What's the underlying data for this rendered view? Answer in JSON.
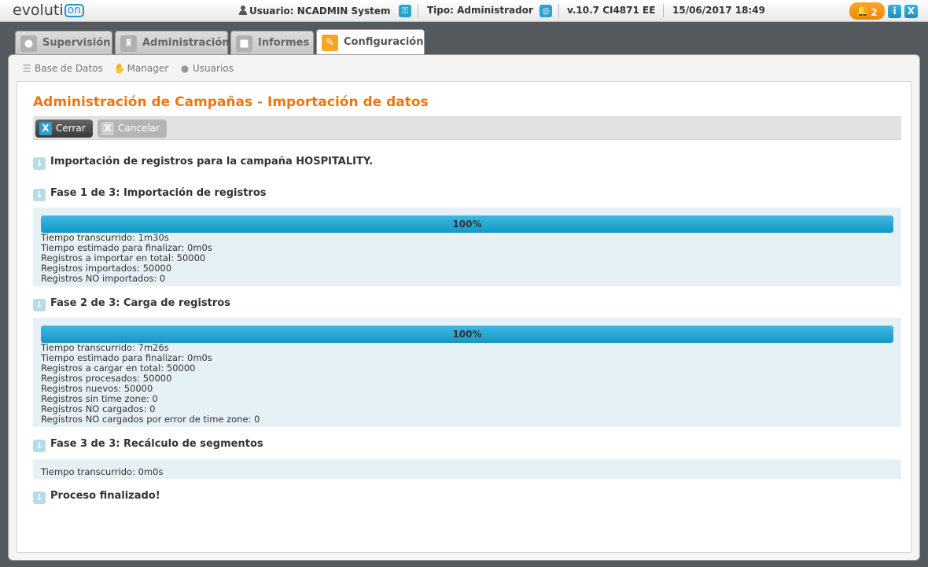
{
  "topbar": {
    "logo_text": "evoluti",
    "logo_badge": "on",
    "user_label": "Usuario: NCADMIN System",
    "type_label": "Tipo: Administrador",
    "version_label": "v.10.7 CI4871 EE",
    "datetime_label": "15/06/2017 18:49",
    "notification_count": "2",
    "info_label": "i",
    "close_label": "X"
  },
  "tabs": [
    {
      "label": "Supervisión"
    },
    {
      "label": "Administración"
    },
    {
      "label": "Informes"
    },
    {
      "label": "Configuración",
      "active": true
    }
  ],
  "subnav": [
    {
      "label": "Base de Datos"
    },
    {
      "label": "Manager"
    },
    {
      "label": "Usuarios"
    }
  ],
  "page": {
    "title": "Administración de Campañas - Importación de datos",
    "close_button": "Cerrar",
    "cancel_button": "Cancelar",
    "button_x": "X"
  },
  "intro": "Importación de registros para la campaña HOSPITALITY.",
  "phase1": {
    "title": "Fase 1 de 3: Importación de registros",
    "progress_percent": 100,
    "progress_label": "100%",
    "lines": [
      "Tiempo transcurrido: 1m30s",
      "Tiempo estimado para finalizar: 0m0s",
      "Registros a importar en total: 50000",
      "Registros importados: 50000",
      "Registros NO importados: 0"
    ]
  },
  "phase2": {
    "title": "Fase 2 de 3: Carga de registros",
    "progress_percent": 100,
    "progress_label": "100%",
    "lines": [
      "Tiempo transcurrido: 7m26s",
      "Tiempo estimado para finalizar: 0m0s",
      "Registros a cargar en total: 50000",
      "Registros procesados: 50000",
      "Registros nuevos: 50000",
      "Registros sin time zone: 0",
      "Registros NO cargados: 0",
      "Registros NO cargados por error de time zone: 0"
    ]
  },
  "phase3": {
    "title": "Fase 3 de 3: Recálculo de segmentos",
    "lines": [
      "Tiempo transcurrido: 0m0s"
    ]
  },
  "final": "Proceso finalizado!",
  "colors": {
    "accent_orange": "#e77817",
    "progress_blue": "#1e9bc4",
    "phase_bg": "#e6f1f6"
  }
}
